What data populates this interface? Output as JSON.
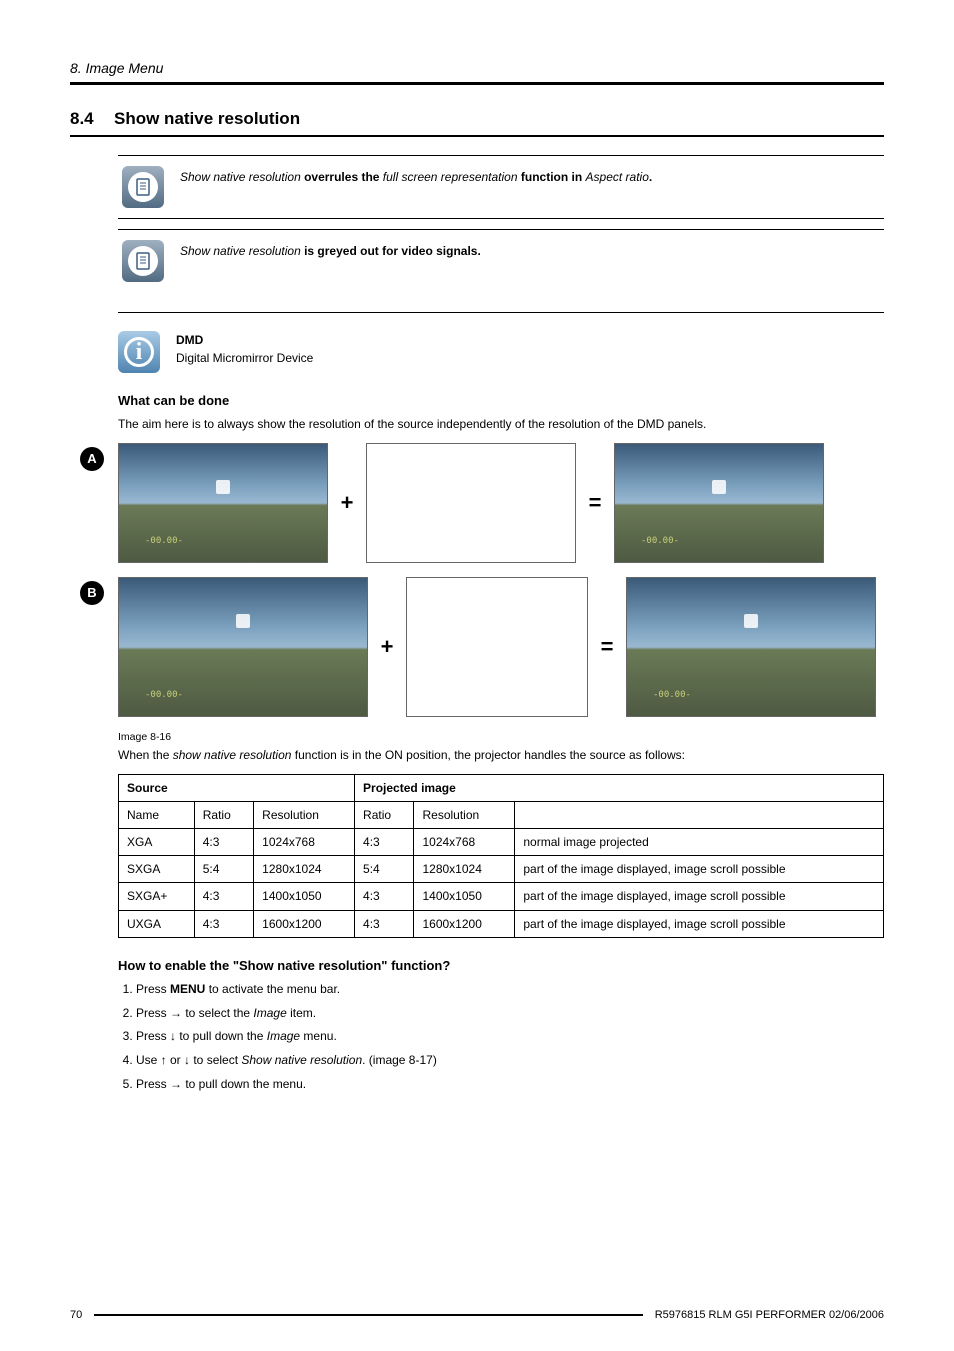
{
  "chapter": "8. Image Menu",
  "section": {
    "num": "8.4",
    "title": "Show native resolution"
  },
  "note1": {
    "pre": "Show native resolution",
    "mid": " overrules the ",
    "em": "full screen representation",
    "post": " function in ",
    "em2": "Aspect ratio",
    "end": "."
  },
  "note2": {
    "pre": "Show native resolution",
    "post": " is greyed out for video signals."
  },
  "info": {
    "term": "DMD",
    "desc": "Digital Micromirror Device"
  },
  "subhead1": "What can be done",
  "body1": "The aim here is to always show the resolution of the source independently of the resolution of the DMD panels.",
  "diagram": {
    "labelA": "A",
    "labelB": "B",
    "plus": "+",
    "eq": "="
  },
  "imgcap": "Image 8-16",
  "followcap_pre": "When the ",
  "followcap_em": "show native resolution",
  "followcap_post": " function is in the ON position, the projector handles the source as follows:",
  "table": {
    "head_src": "Source",
    "head_proj": "Projected image",
    "cols": [
      "Name",
      "Ratio",
      "Resolution",
      "Ratio",
      "Resolution",
      ""
    ],
    "rows": [
      [
        "XGA",
        "4:3",
        "1024x768",
        "4:3",
        "1024x768",
        "normal image projected"
      ],
      [
        "SXGA",
        "5:4",
        "1280x1024",
        "5:4",
        "1280x1024",
        "part of the image displayed, image scroll possible"
      ],
      [
        "SXGA+",
        "4:3",
        "1400x1050",
        "4:3",
        "1400x1050",
        "part of the image displayed, image scroll possible"
      ],
      [
        "UXGA",
        "4:3",
        "1600x1200",
        "4:3",
        "1600x1200",
        "part of the image displayed, image scroll possible"
      ]
    ]
  },
  "subhead2": "How to enable the \"Show native resolution\" function?",
  "steps": [
    {
      "pre": "Press ",
      "b": "MENU",
      "post": " to activate the menu bar."
    },
    {
      "pre": "Press → to select the ",
      "i": "Image",
      "post": " item."
    },
    {
      "pre": "Press ↓ to pull down the ",
      "i": "Image",
      "post": " menu."
    },
    {
      "pre": "Use ↑ or ↓ to select ",
      "i": "Show native resolution",
      "post": ". (image 8-17)"
    },
    {
      "pre": "Press → to pull down the menu.",
      "i": "",
      "post": ""
    }
  ],
  "footer": {
    "page": "70",
    "doc": "R5976815  RLM G5I PERFORMER  02/06/2006"
  }
}
